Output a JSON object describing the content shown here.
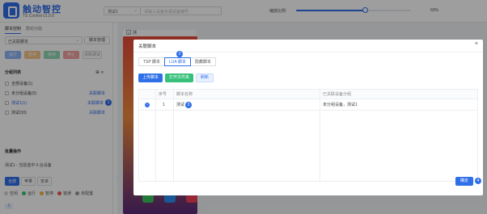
{
  "header": {
    "logo_title": "触动智控",
    "logo_sub": "TS Control v1.0.0",
    "device_select": "测试1",
    "search_placeholder": "请输入设备名或设备编号",
    "zoom_label": "缩放比例:",
    "zoom_value": "60%",
    "zoom_fraction": 0.6
  },
  "left": {
    "tabs": [
      "脚本控制",
      "群组功能"
    ],
    "script_select": "已关联脚本",
    "manage_button": "脚本管理",
    "actions": [
      {
        "label": "运行",
        "color": "#8fb4f5"
      },
      {
        "label": "暂停",
        "color": "#f5c38a"
      },
      {
        "label": "继续",
        "color": "#8fd7b0"
      },
      {
        "label": "停止",
        "color": "#f2a0a0"
      },
      {
        "label": "清除调试",
        "color": ""
      }
    ],
    "group_title": "分组列表",
    "groups": [
      {
        "label": "全部设备(1)",
        "link": "",
        "badge": ""
      },
      {
        "label": "未分组设备(0)",
        "link": "关联脚本",
        "badge": ""
      },
      {
        "label": "测试1(1)",
        "link": "关联脚本",
        "badge": "1"
      },
      {
        "label": "测试2(0)",
        "link": "关联脚本",
        "badge": ""
      }
    ],
    "batch_title": "批量操作",
    "batch_text": "测试1 - 当前选中 0 台设备",
    "pill_tabs": [
      "全部",
      "苹果",
      "安卓"
    ],
    "legend": [
      {
        "label": "空闲",
        "color": "#d0d3d8"
      },
      {
        "label": "运行",
        "color": "#37c07a"
      },
      {
        "label": "暂停",
        "color": "#f0b93a"
      },
      {
        "label": "错误",
        "color": "#e8574d"
      },
      {
        "label": "未配置",
        "color": "#999999"
      }
    ],
    "page_num": "1"
  },
  "workspace": {
    "screen_index": "1",
    "screen_label": "测"
  },
  "modal": {
    "title": "关联脚本",
    "close": "×",
    "tabs": [
      "TSP 脚本",
      "LUA 脚本",
      "隐藏脚本"
    ],
    "tab_badge": "2",
    "buttons": [
      "上传脚本",
      "打开文件夹",
      "刷新"
    ],
    "columns": [
      "序号",
      "脚本名称",
      "已关联设备分组"
    ],
    "rows": [
      {
        "index": "1",
        "name": "测试",
        "groups": "未分组设备，测试1",
        "badge": "3"
      }
    ],
    "confirm": "确定",
    "confirm_badge": "4"
  }
}
